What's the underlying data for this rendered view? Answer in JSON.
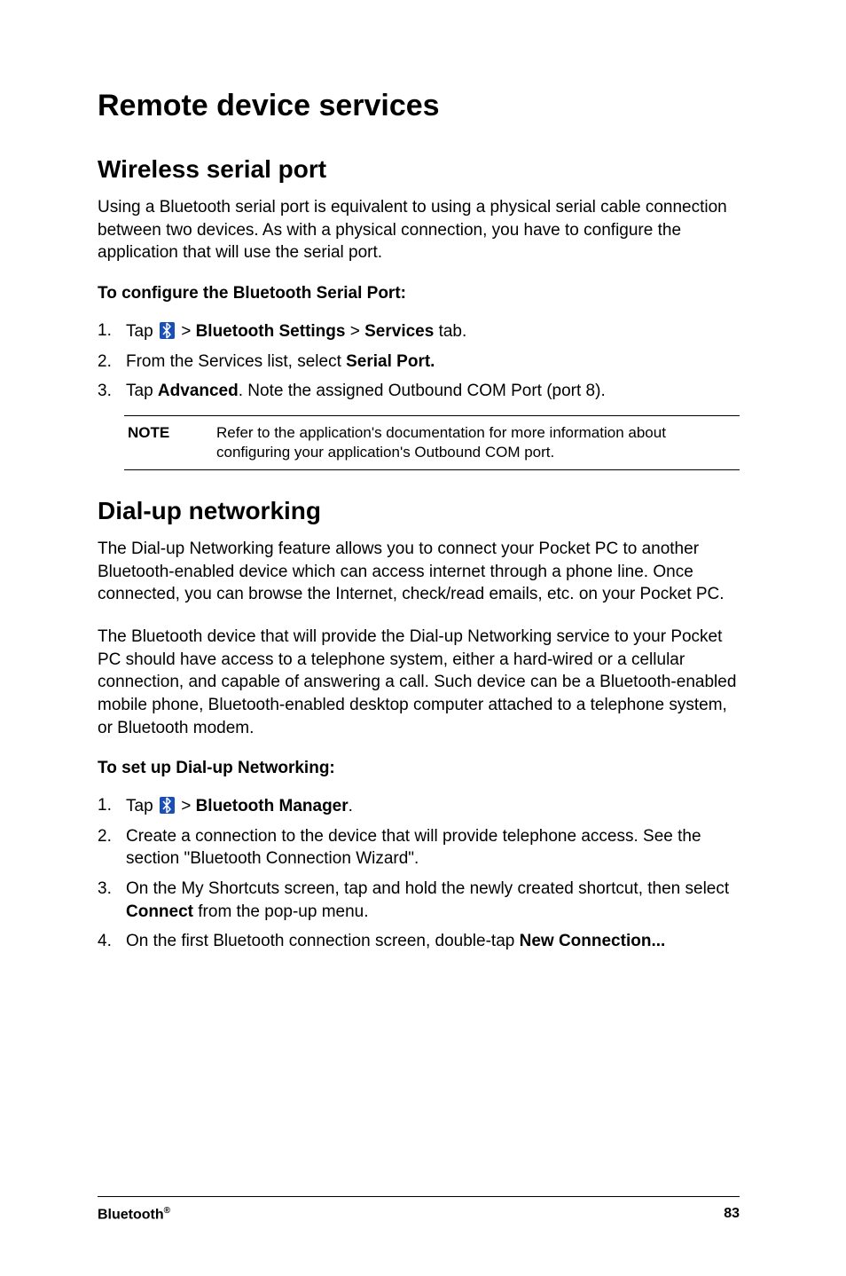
{
  "title": "Remote device services",
  "section1": {
    "heading": "Wireless serial port",
    "para1": "Using a Bluetooth serial port is equivalent to using a physical serial cable connection between two devices. As with a physical connection, you have to configure the application that will use the serial port.",
    "sub1": "To configure the Bluetooth Serial Port:",
    "list": [
      {
        "num": "1.",
        "parts": [
          {
            "t": "Tap "
          },
          {
            "icon": "bluetooth-icon"
          },
          {
            "t": " > "
          },
          {
            "t": "Bluetooth Settings",
            "b": true
          },
          {
            "t": " > "
          },
          {
            "t": "Services",
            "b": true
          },
          {
            "t": " tab."
          }
        ]
      },
      {
        "num": "2.",
        "parts": [
          {
            "t": "From the Services list, select "
          },
          {
            "t": "Serial Port.",
            "b": true
          }
        ]
      },
      {
        "num": "3.",
        "parts": [
          {
            "t": "Tap "
          },
          {
            "t": "Advanced",
            "b": true
          },
          {
            "t": ". Note the assigned Outbound COM Port (port 8)."
          }
        ]
      }
    ],
    "note_label": "NOTE",
    "note_text": "Refer to the application's documentation for more information about configuring your application's Outbound COM port."
  },
  "section2": {
    "heading": "Dial-up networking",
    "para1": "The Dial-up Networking feature allows you to connect your Pocket PC to another Bluetooth-enabled device which can access internet through a phone line. Once connected, you can browse the Internet, check/read emails, etc. on your Pocket PC.",
    "para2": "The Bluetooth device that will provide the Dial-up Networking service to your Pocket PC should have access to a telephone system, either a hard-wired or a cellular connection, and capable of answering a call.  Such device can be a Bluetooth-enabled mobile phone, Bluetooth-enabled desktop computer attached to a telephone system, or Bluetooth modem.",
    "sub1": "To set up Dial-up Networking:",
    "list": [
      {
        "num": "1.",
        "parts": [
          {
            "t": "Tap "
          },
          {
            "icon": "bluetooth-icon"
          },
          {
            "t": " > "
          },
          {
            "t": "Bluetooth Manager",
            "b": true
          },
          {
            "t": "."
          }
        ]
      },
      {
        "num": "2.",
        "parts": [
          {
            "t": "Create a connection to the device that will provide telephone access. See the section \"Bluetooth Connection Wizard\"."
          }
        ]
      },
      {
        "num": "3.",
        "parts": [
          {
            "t": "On the My Shortcuts screen, tap and hold the newly created shortcut, then select "
          },
          {
            "t": "Connect",
            "b": true
          },
          {
            "t": " from the pop-up menu."
          }
        ]
      },
      {
        "num": "4.",
        "parts": [
          {
            "t": "On the first Bluetooth connection screen, double-tap "
          },
          {
            "t": "New Connection...",
            "b": true
          }
        ]
      }
    ]
  },
  "footer": {
    "left": "Bluetooth",
    "sup": "®",
    "right": "83"
  }
}
